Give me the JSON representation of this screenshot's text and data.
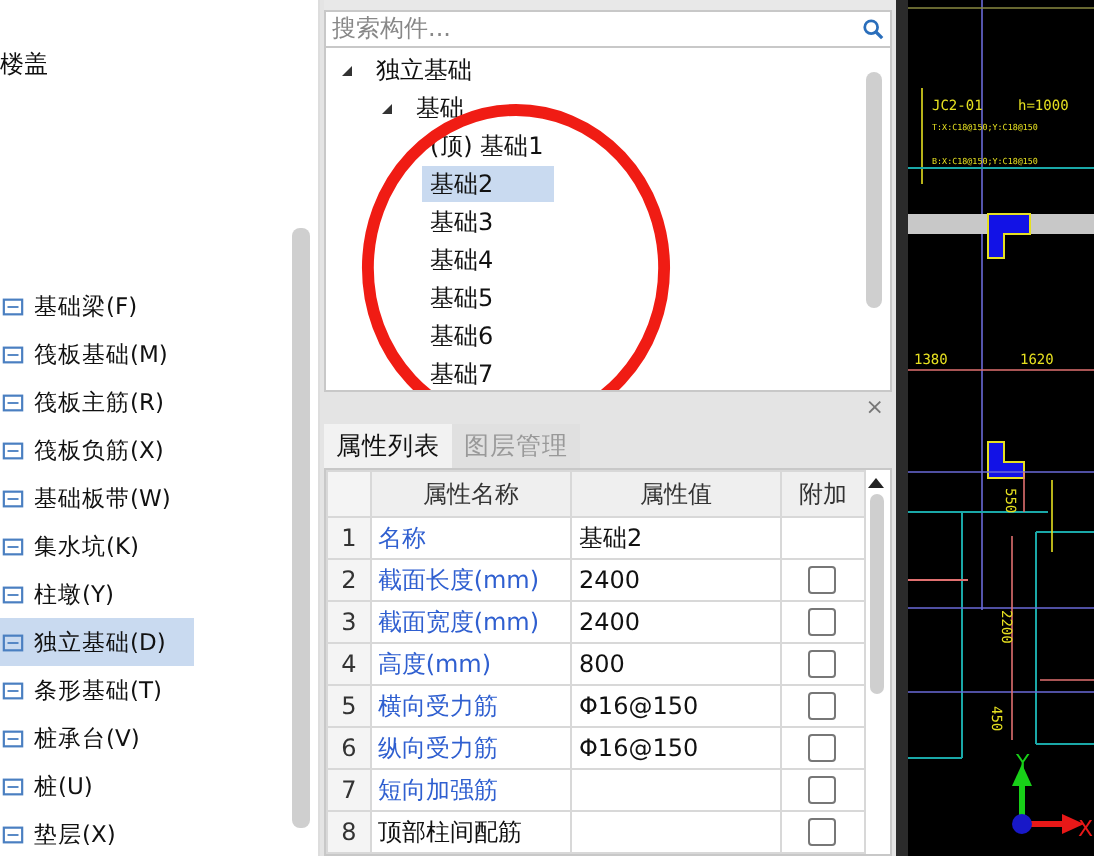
{
  "left_panel": {
    "heading": "楼盖",
    "items": [
      {
        "label": "基础梁(F)",
        "selected": false
      },
      {
        "label": "筏板基础(M)",
        "selected": false
      },
      {
        "label": "筏板主筋(R)",
        "selected": false
      },
      {
        "label": "筏板负筋(X)",
        "selected": false
      },
      {
        "label": "基础板带(W)",
        "selected": false
      },
      {
        "label": "集水坑(K)",
        "selected": false
      },
      {
        "label": "柱墩(Y)",
        "selected": false
      },
      {
        "label": "独立基础(D)",
        "selected": true
      },
      {
        "label": "条形基础(T)",
        "selected": false
      },
      {
        "label": "桩承台(V)",
        "selected": false
      },
      {
        "label": "桩(U)",
        "selected": false
      },
      {
        "label": "垫层(X)",
        "selected": false
      }
    ]
  },
  "search": {
    "placeholder": "搜索构件..."
  },
  "tree": [
    {
      "label": "独立基础",
      "expanded": true,
      "selected": false,
      "children": [
        {
          "label": "基础",
          "expanded": true,
          "selected": false,
          "children": [
            {
              "label": "(顶) 基础1",
              "selected": false
            },
            {
              "label": "基础2",
              "selected": true
            },
            {
              "label": "基础3",
              "selected": false
            },
            {
              "label": "基础4",
              "selected": false
            },
            {
              "label": "基础5",
              "selected": false
            },
            {
              "label": "基础6",
              "selected": false
            },
            {
              "label": "基础7",
              "selected": false
            }
          ]
        }
      ]
    }
  ],
  "close_symbol": "×",
  "tabs": [
    {
      "label": "属性列表",
      "selected": true
    },
    {
      "label": "图层管理",
      "selected": false
    }
  ],
  "properties": {
    "columns": [
      "属性名称",
      "属性值",
      "附加"
    ],
    "rows": [
      {
        "index": "1",
        "name": "名称",
        "value": "基础2",
        "public": true
      },
      {
        "index": "2",
        "name": "截面长度(mm)",
        "value": "2400",
        "public": true,
        "checked": false
      },
      {
        "index": "3",
        "name": "截面宽度(mm)",
        "value": "2400",
        "public": true,
        "checked": false
      },
      {
        "index": "4",
        "name": "高度(mm)",
        "value": "800",
        "public": true,
        "checked": false
      },
      {
        "index": "5",
        "name": "横向受力筋",
        "value": "Φ16@150",
        "public": true,
        "checked": false
      },
      {
        "index": "6",
        "name": "纵向受力筋",
        "value": "Φ16@150",
        "public": true,
        "checked": false
      },
      {
        "index": "7",
        "name": "短向加强筋",
        "value": "",
        "public": true,
        "checked": false
      },
      {
        "index": "8",
        "name": "顶部柱间配筋",
        "value": "",
        "public": false,
        "checked": false
      }
    ]
  },
  "cad": {
    "labels": [
      "JC2-01",
      "h=1000",
      "T:X:C18@150;Y:C18@150",
      "B:X:C18@150;Y:C18@150"
    ],
    "dims": [
      "1380",
      "1620",
      "550",
      "2200",
      "450"
    ],
    "axis_y": "Y",
    "axis_x": "X"
  }
}
